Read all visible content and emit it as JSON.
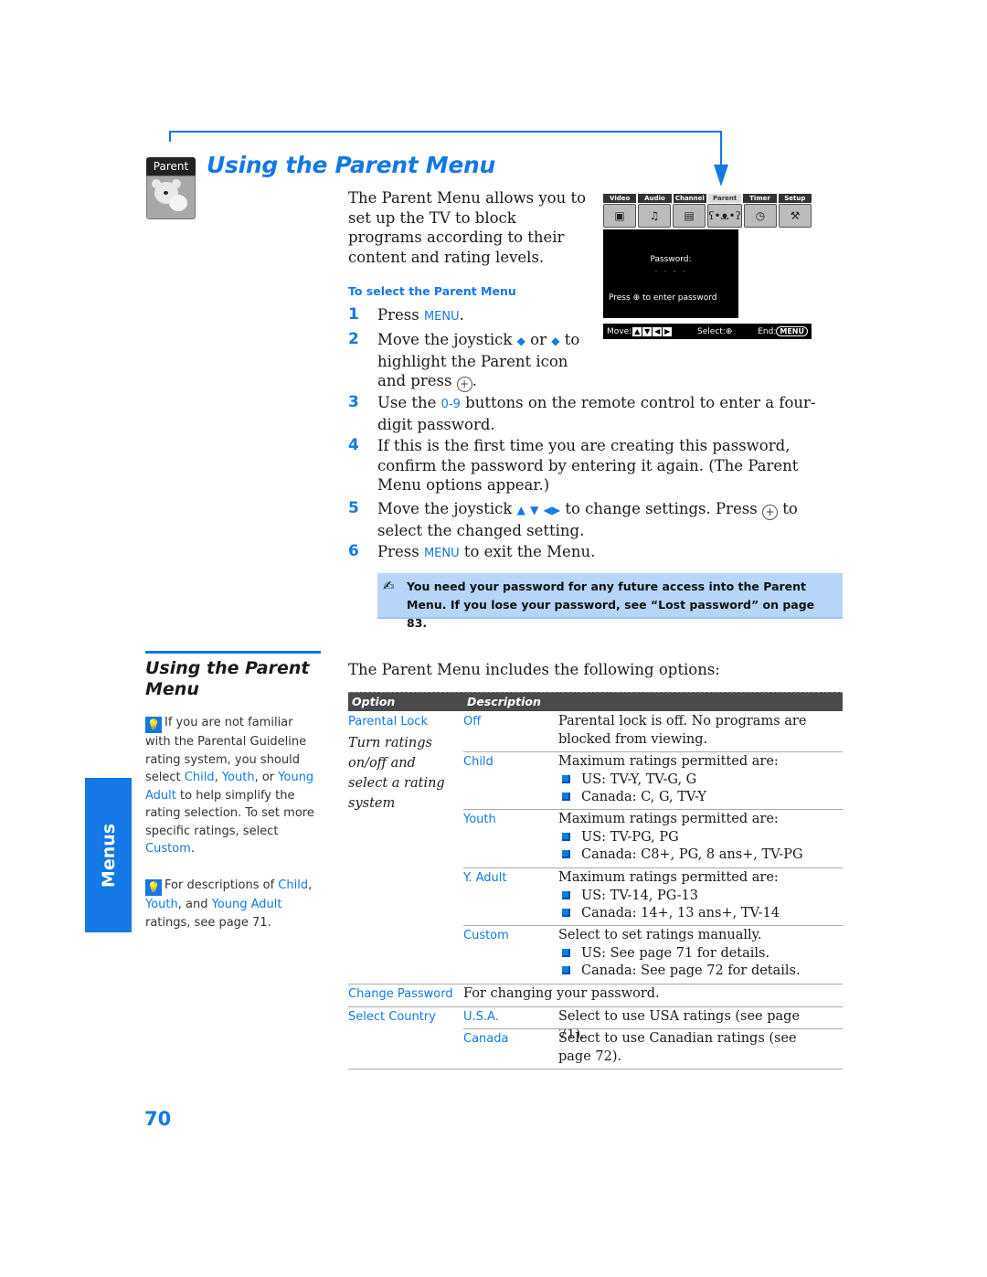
{
  "header": {
    "icon_label": "Parent",
    "title": "Using the Parent Menu"
  },
  "intro": "The Parent Menu allows you to set up the TV to block programs according to their content and rating levels.",
  "tv_screen": {
    "tabs": [
      "Video",
      "Audio",
      "Channel",
      "Parent",
      "Timer",
      "Setup"
    ],
    "active_tab": "Parent",
    "password_label": "Password:",
    "password_value": "- - - -",
    "hint_pre": "Press",
    "hint_post": "to enter password",
    "bar_move": "Move:",
    "bar_select": "Select:",
    "bar_end": "End:",
    "bar_menu": "MENU"
  },
  "procedure": {
    "heading": "To select the Parent Menu",
    "steps": [
      {
        "num": "1",
        "pre": "Press ",
        "kw": "MENU",
        "post": "."
      },
      {
        "num": "2",
        "pre": "Move the joystick",
        "mid": "or",
        "post": "to highlight the Parent icon and press",
        "end": "."
      },
      {
        "num": "3",
        "pre": "Use the ",
        "kw": "0-9",
        "post": " buttons on the remote control to enter a four-digit password."
      },
      {
        "num": "4",
        "text": "If this is the first time you are creating this password, confirm the password by entering it again. (The Parent Menu options appear.)"
      },
      {
        "num": "5",
        "pre": "Move the joystick",
        "mid": "to change settings. Press",
        "post": "to select the changed setting."
      },
      {
        "num": "6",
        "pre": "Press ",
        "kw": "MENU",
        "post": " to exit the Menu."
      }
    ]
  },
  "note": "You need your password for any future access into the Parent Menu. If you lose your password, see “Lost password” on page 83.",
  "sidebar": {
    "title": "Using the Parent Menu",
    "tip1": {
      "pre": "If you are not familiar with the Parental Guideline rating system, you should select ",
      "child": "Child",
      "youth": "Youth",
      "or": ", or ",
      "young_adult": "Young Adult",
      "mid": " to help simplify the rating selection. To set more specific ratings, select ",
      "custom": "Custom",
      "end": "."
    },
    "tip2": {
      "pre": "For descriptions of ",
      "child": "Child",
      "youth": "Youth",
      "and": ", and ",
      "young_adult": "Young Adult",
      "end": " ratings, see page 71."
    },
    "section_tab": "Menus"
  },
  "table": {
    "intro": "The Parent Menu includes the following options:",
    "headers": [
      "Option",
      "Description"
    ],
    "parental_lock": {
      "label": "Parental Lock",
      "desc": "Turn ratings on/off and select a rating system",
      "rows": [
        {
          "option": "Off",
          "text": "Parental lock is off. No programs are blocked from viewing.",
          "bullets": []
        },
        {
          "option": "Child",
          "text": "Maximum ratings permitted are:",
          "bullets": [
            "US: TV-Y, TV-G, G",
            "Canada: C, G, TV-Y"
          ]
        },
        {
          "option": "Youth",
          "text": "Maximum ratings permitted are:",
          "bullets": [
            "US: TV-PG, PG",
            "Canada: C8+, PG, 8 ans+, TV-PG"
          ]
        },
        {
          "option": "Y. Adult",
          "text": "Maximum ratings permitted are:",
          "bullets": [
            "US: TV-14, PG-13",
            "Canada: 14+, 13 ans+, TV-14"
          ]
        },
        {
          "option": "Custom",
          "text": "Select to set ratings manually.",
          "bullets": [
            "US: See page 71 for details.",
            "Canada: See page 72 for details."
          ]
        }
      ]
    },
    "change_password": {
      "label": "Change Password",
      "text": "For changing your password."
    },
    "select_country": {
      "label": "Select Country",
      "rows": [
        {
          "option": "U.S.A.",
          "text": "Select to use USA ratings (see page 71)."
        },
        {
          "option": "Canada",
          "text": "Select to use Canadian ratings (see page 72)."
        }
      ]
    }
  },
  "page_number": "70",
  "colors": {
    "accent": "#1478e6",
    "note_bg": "#b7d5f6",
    "table_header": "#4a4a4a"
  }
}
